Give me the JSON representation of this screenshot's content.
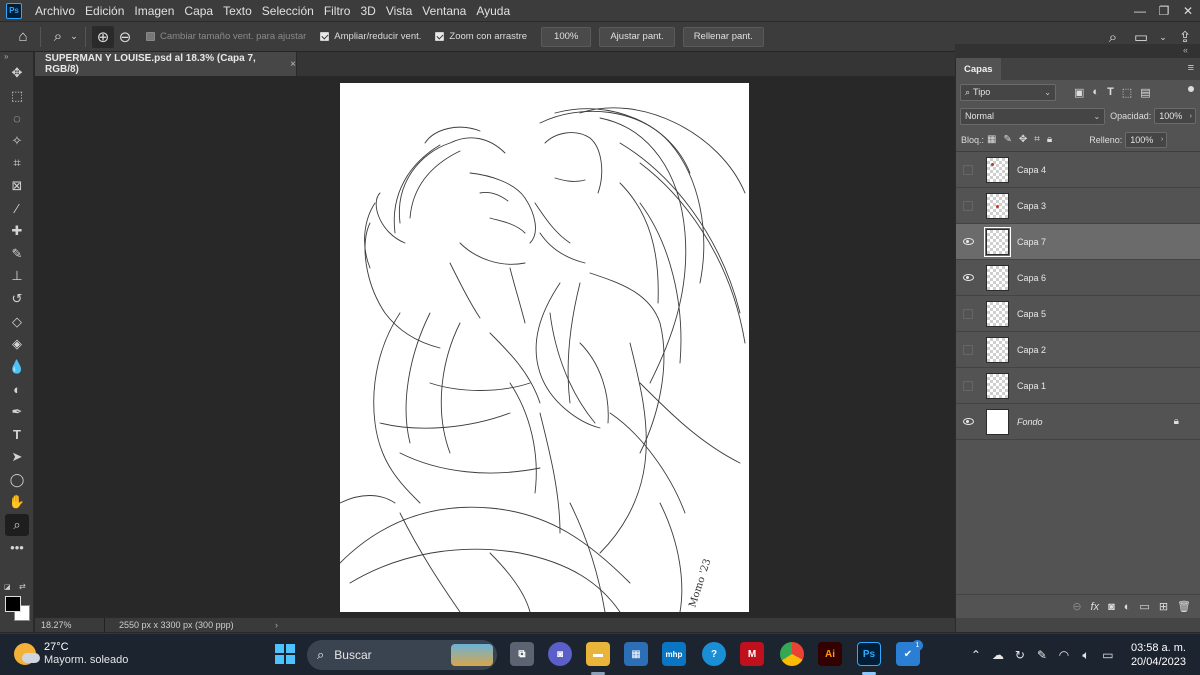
{
  "menubar": {
    "logo": "Ps",
    "items": [
      "Archivo",
      "Edición",
      "Imagen",
      "Capa",
      "Texto",
      "Selección",
      "Filtro",
      "3D",
      "Vista",
      "Ventana",
      "Ayuda"
    ]
  },
  "options": {
    "resize_windows": "Cambiar tamaño vent. para ajustar",
    "zoom_resize": "Ampliar/reducir vent.",
    "scrubby_zoom": "Zoom con arrastre",
    "pct_100": "100%",
    "fit_screen": "Ajustar pant.",
    "fill_screen": "Rellenar pant."
  },
  "document": {
    "tab_title": "SUPERMAN Y LOUISE.psd al 18.3% (Capa 7, RGB/8)",
    "close": "×",
    "signature": "Momo '23"
  },
  "status": {
    "zoom": "18.27%",
    "doc_size": "2550 px x 3300 px (300 ppp)",
    "arrow": "›"
  },
  "layers_panel": {
    "tab": "Capas",
    "filter_type": "Tipo",
    "blend_mode": "Normal",
    "opacity_label": "Opacidad:",
    "opacity": "100%",
    "lock_label": "Bloq.:",
    "fill_label": "Relleno:",
    "fill": "100%",
    "layers": [
      {
        "name": "Capa 4",
        "visible": false,
        "selected": false
      },
      {
        "name": "Capa 3",
        "visible": false,
        "selected": false
      },
      {
        "name": "Capa 7",
        "visible": true,
        "selected": true
      },
      {
        "name": "Capa 6",
        "visible": true,
        "selected": false
      },
      {
        "name": "Capa 5",
        "visible": false,
        "selected": false
      },
      {
        "name": "Capa 2",
        "visible": false,
        "selected": false
      },
      {
        "name": "Capa 1",
        "visible": false,
        "selected": false
      },
      {
        "name": "Fondo",
        "visible": true,
        "selected": false,
        "locked": true
      }
    ]
  },
  "taskbar": {
    "weather_temp": "27°C",
    "weather_desc": "Mayorm. soleado",
    "search_label": "Buscar",
    "time": "03:58 a. m.",
    "date": "20/04/2023",
    "ps_label": "Ps",
    "ai_label": "Ai",
    "mhp_label": "mhp",
    "notification_count": "1"
  },
  "colors": {
    "accent": "#31a8ff",
    "panel_bg": "#535353",
    "selected_layer": "#6b6b6b",
    "canvas": "#ffffff",
    "taskbar": "#1c2430"
  }
}
